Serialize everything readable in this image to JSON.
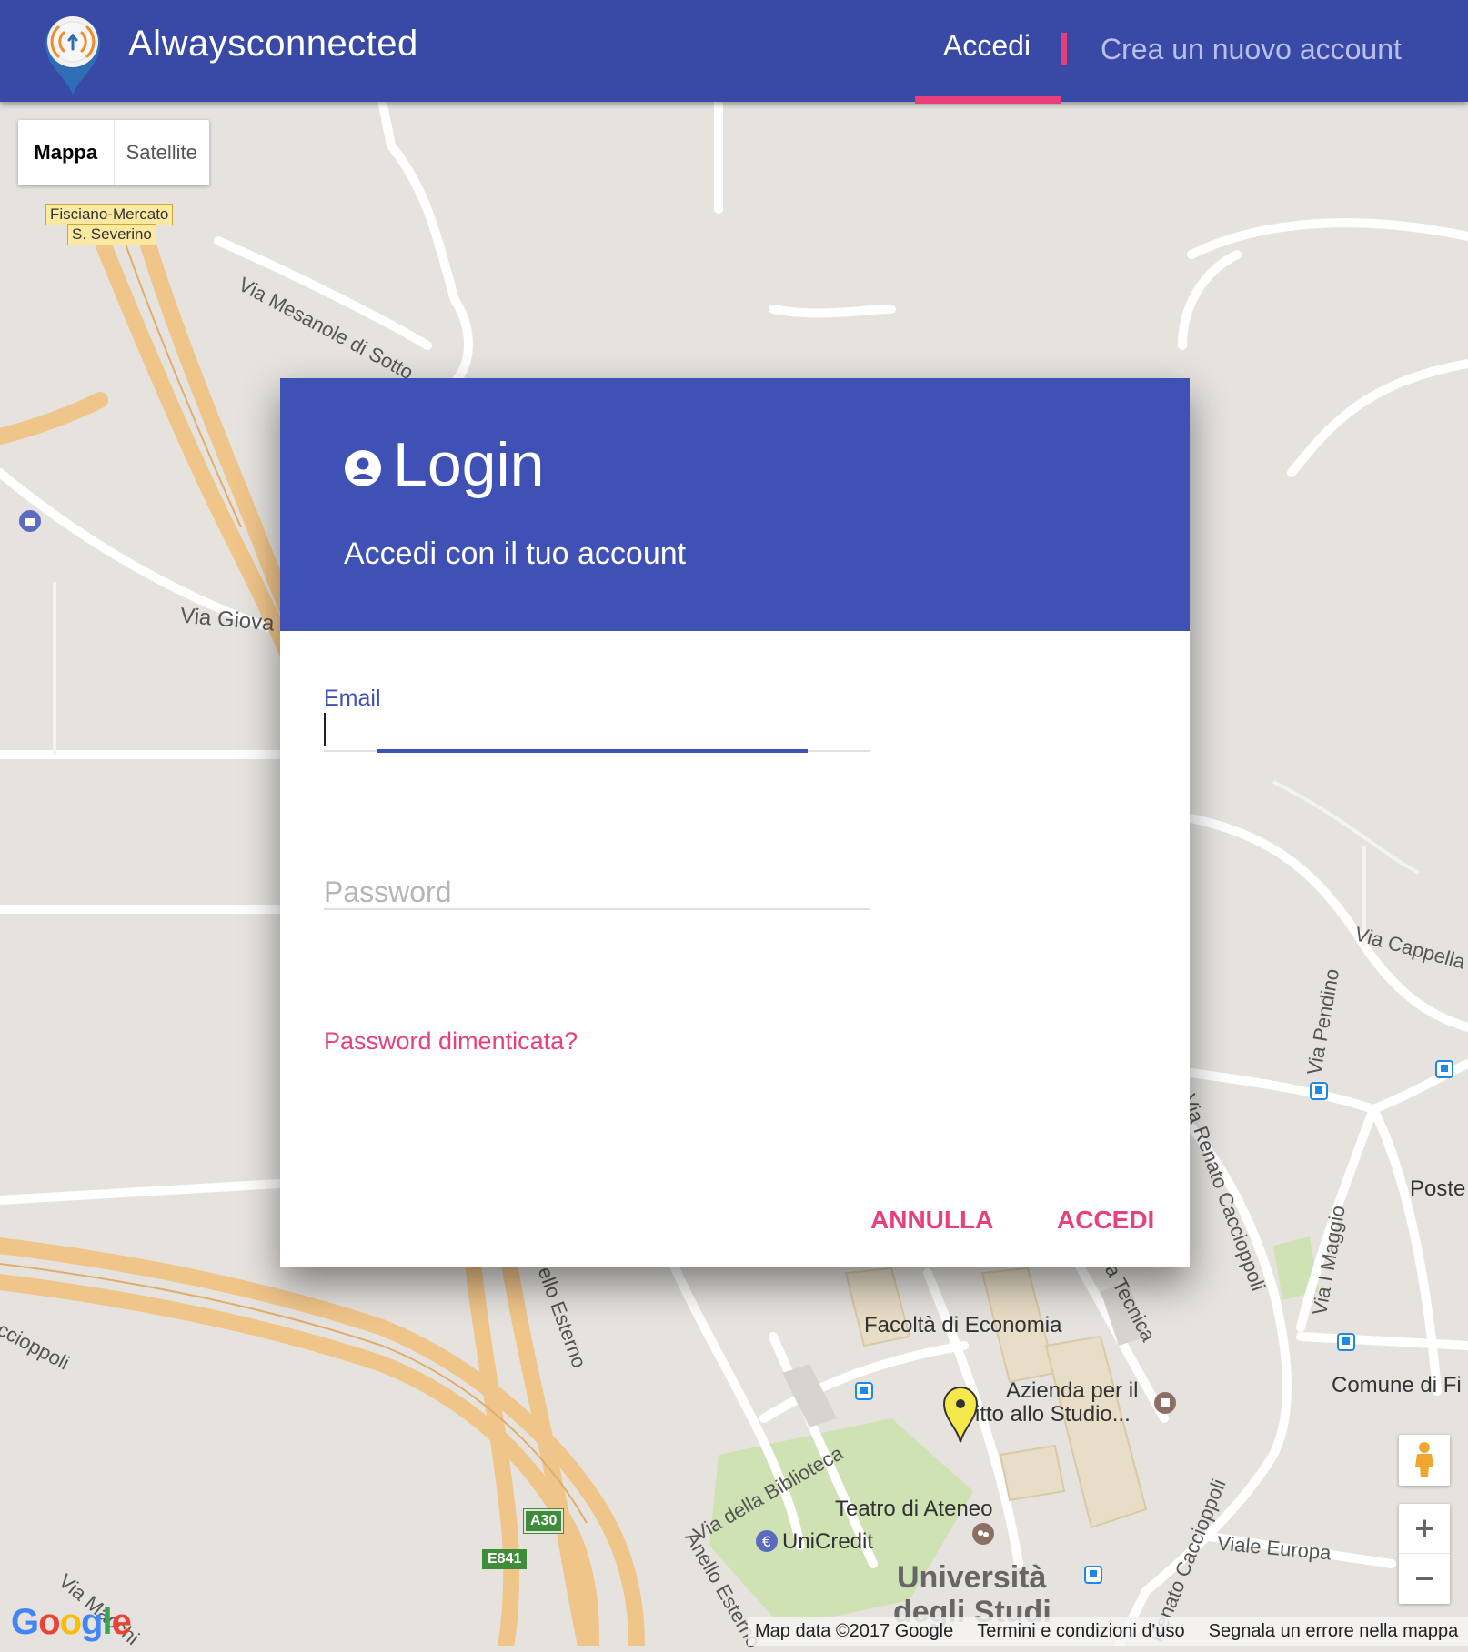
{
  "header": {
    "app_title": "Alwaysconnected",
    "nav_login": "Accedi",
    "nav_register": "Crea un nuovo account"
  },
  "map_type": {
    "map": "Mappa",
    "satellite": "Satellite"
  },
  "map_labels": {
    "station_1": "Fisciano-Mercato",
    "station_2": "S. Severino",
    "via_mesanole": "Via Mesanole di Sotto",
    "via_giova": "Via Giova",
    "via_cappella": "Via Cappella",
    "via_pendino": "Via Pendino",
    "poste": "Poste",
    "via_renato": "Via Renato Caccioppoli",
    "via_maggio": "Via I Maggio",
    "comune": "Comune di Fi",
    "facolta": "Facoltà di Economia",
    "azienda_1": "Azienda per il",
    "azienda_2": "ritto allo Studio...",
    "via_biblioteca": "Via della Biblioteca",
    "teatro": "Teatro di Ateneo",
    "unicredit": "UniCredit",
    "universita_1": "Università",
    "universita_2": "degli Studi",
    "viale_europa": "Viale Europa",
    "anello_esterno": "Anello Esterno",
    "caccioppoli_left": "Caccioppoli",
    "caccioppoli_bottom": "Renato Caccioppoli",
    "via_macchi": "Via Macchi",
    "tecnica": "a Tecnica",
    "ello_esterno": "ello Esterno",
    "a30": "A30",
    "e841": "E841"
  },
  "dialog": {
    "title": "Login",
    "subtitle": "Accedi con il tuo account",
    "email_label": "Email",
    "email_value": "",
    "password_placeholder": "Password",
    "forgot_link": "Password dimenticata?",
    "cancel_button": "ANNULLA",
    "login_button": "ACCEDI"
  },
  "map_footer": {
    "logo": "Google",
    "map_data": "Map data ©2017 Google",
    "terms": "Termini e condizioni d'uso",
    "report": "Segnala un errore nella mappa"
  },
  "icons": {
    "logo": "wifi-pin-icon",
    "user": "account-circle-icon",
    "pegman": "pegman-icon",
    "zoom_in": "+",
    "zoom_out": "−"
  },
  "colors": {
    "header_bg": "#3949a6",
    "dialog_header_bg": "#3f51b5",
    "accent": "#e8407c"
  }
}
